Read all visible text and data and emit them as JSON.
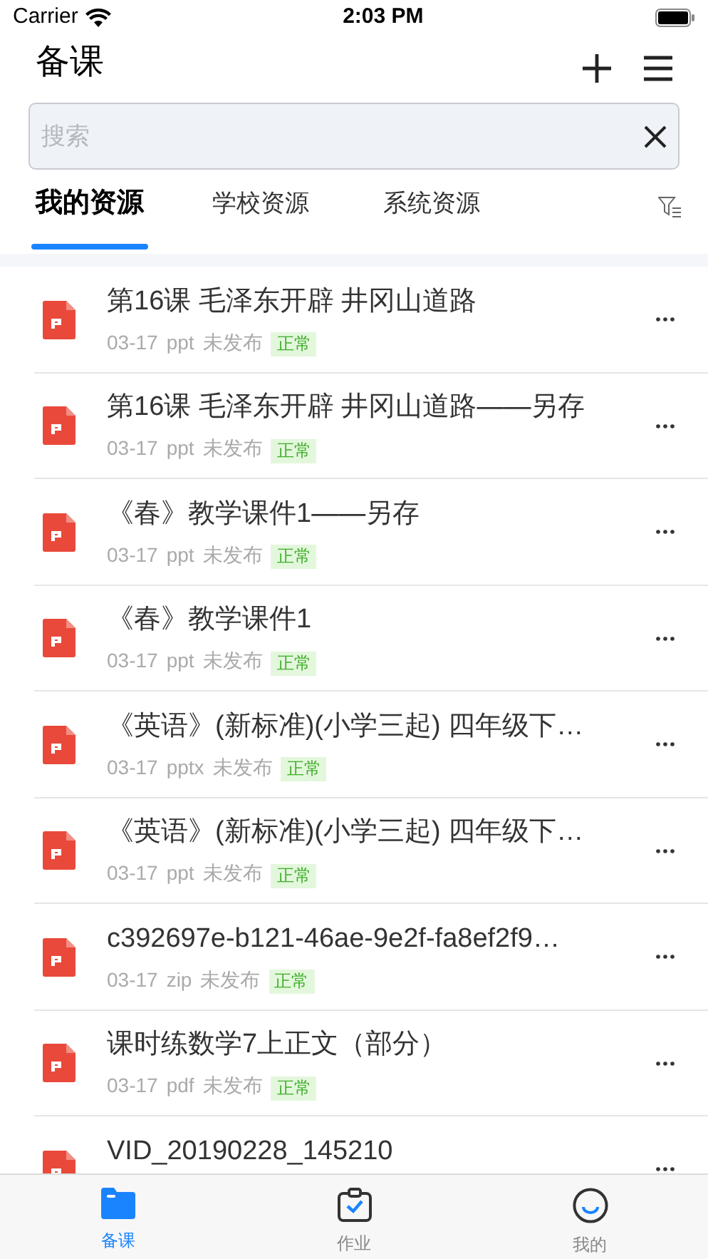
{
  "status_bar": {
    "carrier": "Carrier",
    "time": "2:03 PM"
  },
  "header": {
    "title": "备课"
  },
  "search": {
    "placeholder": "搜索"
  },
  "tabs": [
    {
      "label": "我的资源",
      "selected": true
    },
    {
      "label": "学校资源",
      "selected": false
    },
    {
      "label": "系统资源",
      "selected": false
    }
  ],
  "files": [
    {
      "title": "第16课 毛泽东开辟 井冈山道路",
      "date": "03-17",
      "type": "ppt",
      "publish": "未发布",
      "status": "正常"
    },
    {
      "title": "第16课 毛泽东开辟 井冈山道路——另存",
      "date": "03-17",
      "type": "ppt",
      "publish": "未发布",
      "status": "正常"
    },
    {
      "title": "《春》教学课件1——另存",
      "date": "03-17",
      "type": "ppt",
      "publish": "未发布",
      "status": "正常"
    },
    {
      "title": "《春》教学课件1",
      "date": "03-17",
      "type": "ppt",
      "publish": "未发布",
      "status": "正常"
    },
    {
      "title": "《英语》(新标准)(小学三起) 四年级下…",
      "date": "03-17",
      "type": "pptx",
      "publish": "未发布",
      "status": "正常"
    },
    {
      "title": "《英语》(新标准)(小学三起) 四年级下…",
      "date": "03-17",
      "type": "ppt",
      "publish": "未发布",
      "status": "正常"
    },
    {
      "title": "c392697e-b121-46ae-9e2f-fa8ef2f9…",
      "date": "03-17",
      "type": "zip",
      "publish": "未发布",
      "status": "正常"
    },
    {
      "title": "课时练数学7上正文（部分）",
      "date": "03-17",
      "type": "pdf",
      "publish": "未发布",
      "status": "正常"
    },
    {
      "title": "VID_20190228_145210"
    }
  ],
  "tab_bar": [
    {
      "kind": "folder",
      "label": "备课",
      "selected": true
    },
    {
      "kind": "clipboard",
      "label": "作业",
      "selected": false
    },
    {
      "kind": "smile",
      "label": "我的",
      "selected": false
    }
  ]
}
